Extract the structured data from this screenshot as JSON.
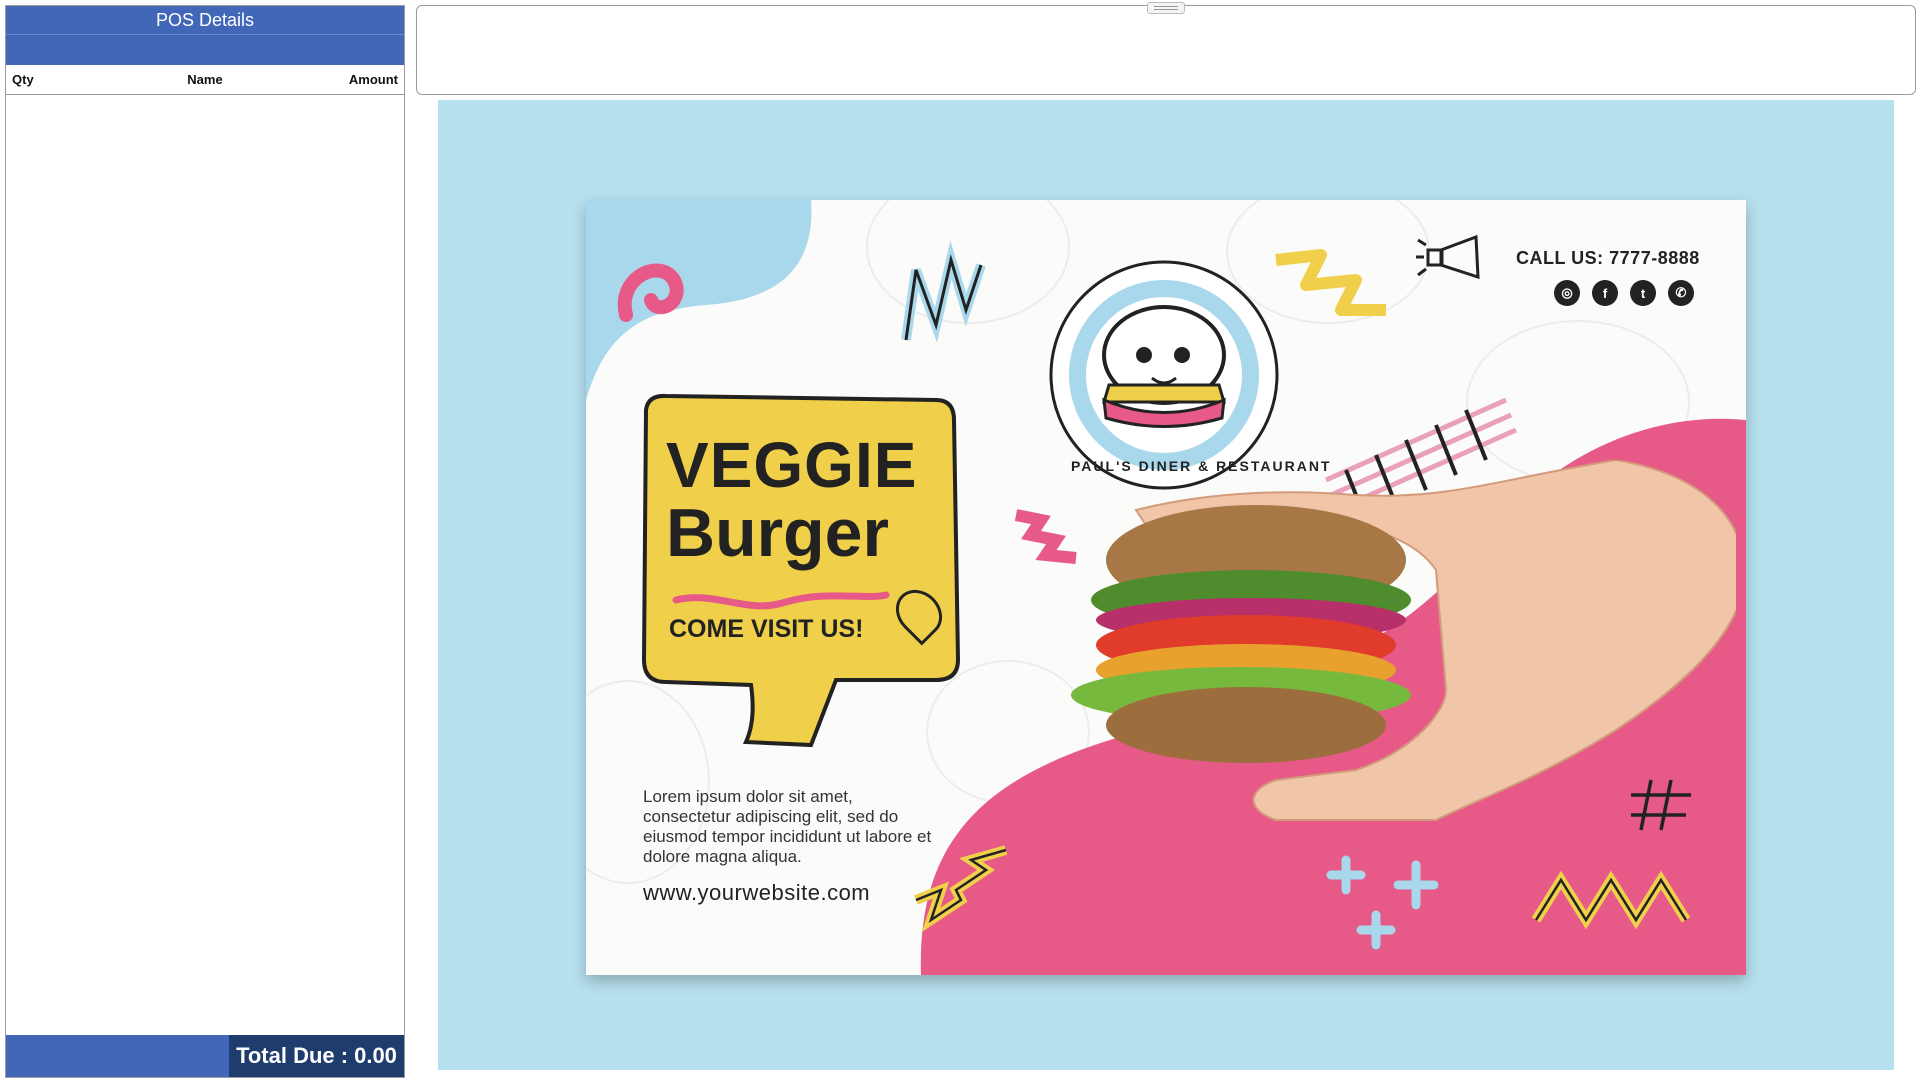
{
  "pos": {
    "title": "POS Details",
    "columns": {
      "qty": "Qty",
      "name": "Name",
      "amount": "Amount"
    },
    "rows": [],
    "total_label": "Total Due :",
    "total_value": "0.00"
  },
  "flyer": {
    "headline_line1": "VEGGIE",
    "headline_line2": "Burger",
    "cta": "COME VISIT US!",
    "body_text": "Lorem ipsum dolor sit amet, consectetur adipiscing elit, sed do eiusmod tempor incididunt ut labore et dolore magna aliqua.",
    "website": "www.yourwebsite.com",
    "phone": "CALL US: 7777-8888",
    "brand_name": "PAUL'S DINER & RESTAURANT",
    "social_icons": [
      "instagram-icon",
      "facebook-icon",
      "twitter-icon",
      "whatsapp-icon"
    ]
  },
  "colors": {
    "pos_header": "#4267b8",
    "pos_total_bg": "#1f3c6e",
    "display_bg": "#b7e1ef",
    "flyer_pink": "#e75a88",
    "flyer_yellow": "#f0d04a",
    "flyer_blue": "#a9d8ec"
  }
}
